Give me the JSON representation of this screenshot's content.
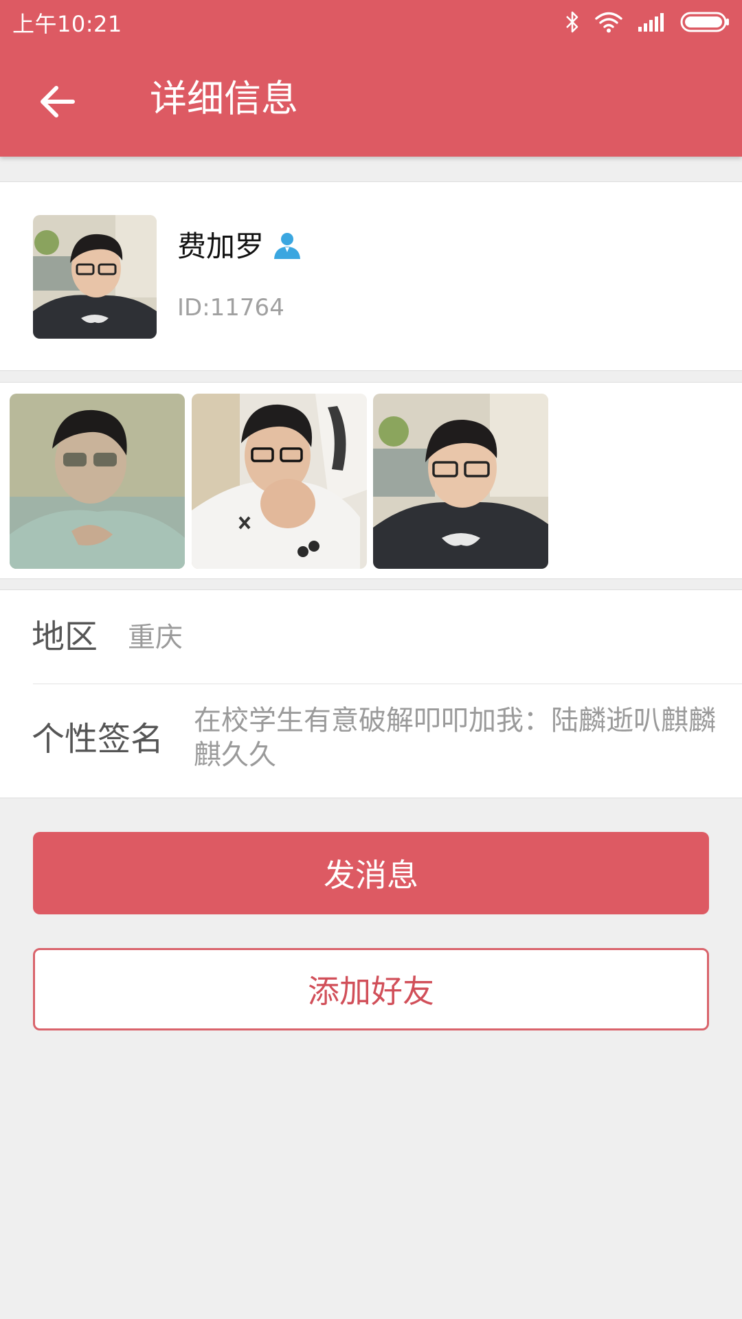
{
  "status_bar": {
    "time": "上午10:21",
    "icons": [
      "bluetooth-icon",
      "wifi-icon",
      "signal-icon",
      "battery-icon"
    ]
  },
  "app_bar": {
    "back_icon": "back-arrow-icon",
    "title": "详细信息"
  },
  "profile": {
    "name": "费加罗",
    "badge_icon": "person-badge-icon",
    "id": "ID:11764"
  },
  "photos": [
    {
      "name": "profile-photo-1"
    },
    {
      "name": "profile-photo-2"
    },
    {
      "name": "profile-photo-3"
    }
  ],
  "info": {
    "region_label": "地区",
    "region_value": "重庆",
    "signature_label": "个性签名",
    "signature_value": "在校学生有意破解叩叩加我：陆麟逝叭麒麟麒久久"
  },
  "actions": {
    "send_message": "发消息",
    "add_friend": "添加好友"
  },
  "colors": {
    "primary": "#dd5a63",
    "background": "#efefef",
    "card": "#ffffff",
    "badge": "#3aa6e0"
  }
}
